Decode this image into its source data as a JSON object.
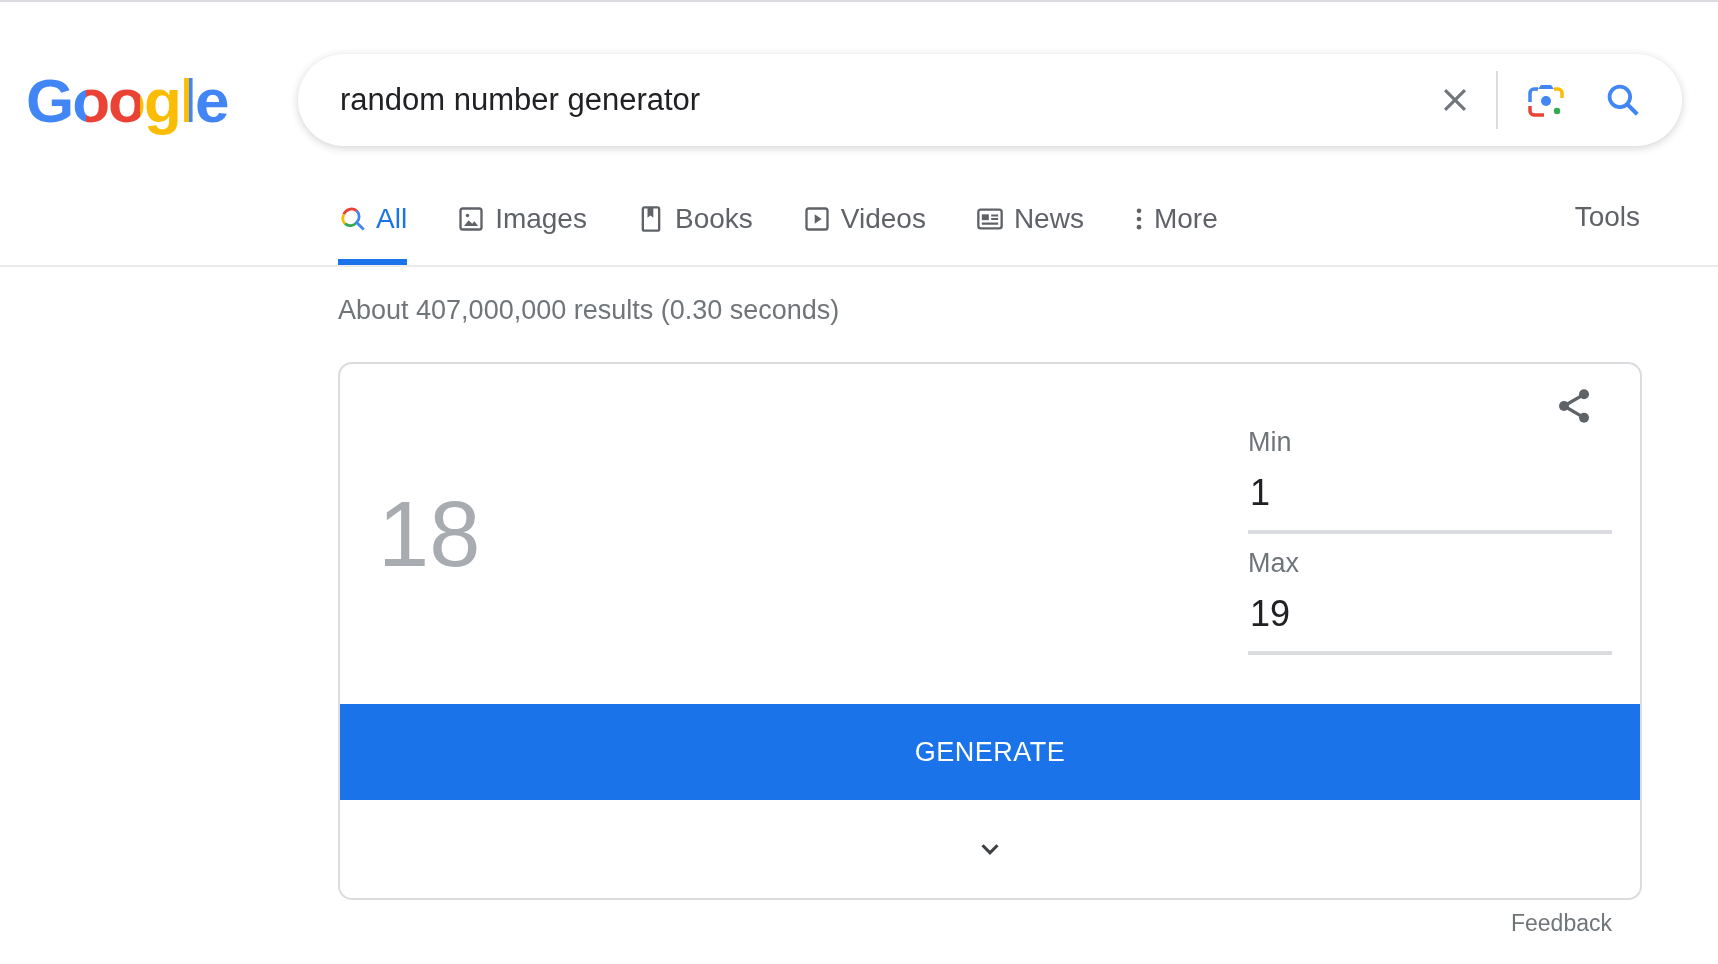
{
  "logo": "Google",
  "search": {
    "value": "random number generator"
  },
  "tabs": [
    {
      "label": "All",
      "kind": "search",
      "selected": true
    },
    {
      "label": "Images",
      "kind": "image",
      "selected": false
    },
    {
      "label": "Books",
      "kind": "book",
      "selected": false
    },
    {
      "label": "Videos",
      "kind": "video",
      "selected": false
    },
    {
      "label": "News",
      "kind": "news",
      "selected": false
    },
    {
      "label": "More",
      "kind": "dots",
      "selected": false
    }
  ],
  "tools": "Tools",
  "result_stats": "About 407,000,000 results (0.30 seconds)",
  "generator": {
    "result": "18",
    "min": {
      "label": "Min",
      "value": "1"
    },
    "max": {
      "label": "Max",
      "value": "19"
    },
    "button": "GENERATE"
  },
  "feedback": "Feedback"
}
